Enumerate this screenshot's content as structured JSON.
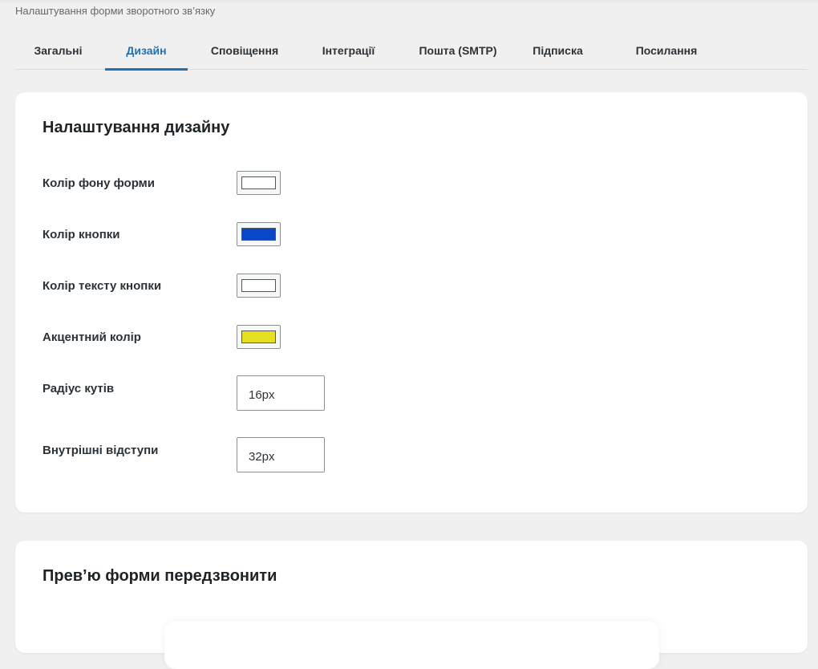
{
  "header": {
    "subtitle": "Налаштування форми зворотного зв’язку"
  },
  "tabs": [
    {
      "label": "Загальні",
      "active": false
    },
    {
      "label": "Дизайн",
      "active": true
    },
    {
      "label": "Сповіщення",
      "active": false
    },
    {
      "label": "Інтеграції",
      "active": false
    },
    {
      "label": "Пошта (SMTP)",
      "active": false
    },
    {
      "label": "Підписка",
      "active": false
    },
    {
      "label": "Посилання",
      "active": false
    }
  ],
  "design": {
    "title": "Налаштування дизайну",
    "fields": [
      {
        "label": "Колір фону форми",
        "type": "color",
        "value": "#ffffff"
      },
      {
        "label": "Колір кнопки",
        "type": "color",
        "value": "#0a46c8"
      },
      {
        "label": "Колір тексту кнопки",
        "type": "color",
        "value": "#ffffff"
      },
      {
        "label": "Акцентний колір",
        "type": "color",
        "value": "#e6e020"
      },
      {
        "label": "Радіус кутів",
        "type": "text",
        "value": "16px"
      },
      {
        "label": "Внутрішні відступи",
        "type": "text",
        "value": "32px"
      }
    ]
  },
  "preview": {
    "title": "Прев’ю форми передзвонити"
  },
  "colors": {
    "accent": "#2271b1",
    "background": "#f0f0f1"
  }
}
